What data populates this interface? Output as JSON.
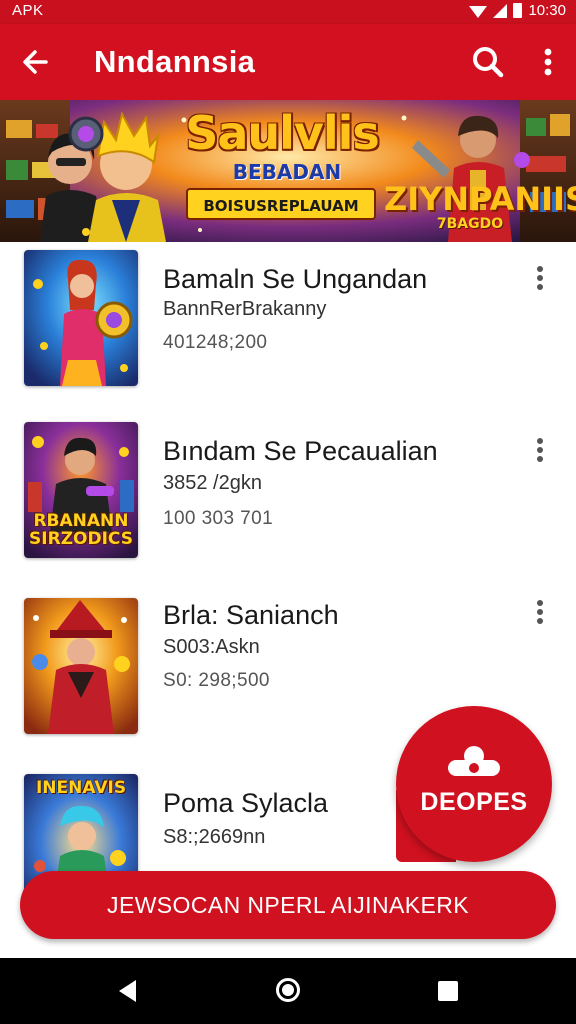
{
  "status_bar": {
    "left_text": "APK",
    "time": "10:30",
    "icons": [
      "wifi-icon",
      "signal-icon",
      "battery-icon"
    ]
  },
  "app_bar": {
    "title": "Nndannsia",
    "icons": [
      "back-arrow-icon",
      "search-icon",
      "more-vert-icon"
    ]
  },
  "banner": {
    "title": "Saulvlis",
    "subtitle_1": "BEBADAN",
    "subtitle_2": "BOISUSREPLAUAM",
    "right_title": "ZIYNPANIIS",
    "right_sub": "7BAGDO"
  },
  "items": [
    {
      "title": "Bamaln Se Ungandan",
      "subtitle": "BannRerBrakanny",
      "meta": "401248;200",
      "thumb_label": ""
    },
    {
      "title": "Bındam Se Pecaualian",
      "subtitle": "3852 /2gkn",
      "meta": "100 303 701",
      "thumb_label": "RBANANN SIRZODICS"
    },
    {
      "title": "Brla: Sanianch",
      "subtitle": "S003:Askn",
      "meta": "S0: 298;500",
      "thumb_label": ""
    },
    {
      "title": "Poma Sylacla",
      "subtitle": "S8:;2669nn",
      "meta": "",
      "thumb_label": "INENAVIS"
    }
  ],
  "fab": {
    "label": "DEOPES",
    "icon": "person-badge-icon"
  },
  "action_button": {
    "label": "JEWSOCAN NPERL AIJINAKERK"
  },
  "nav_bar": {
    "icons": [
      "nav-back-icon",
      "nav-home-icon",
      "nav-recents-icon"
    ]
  },
  "colors": {
    "primary_red": "#d0111f",
    "status_red": "#c8101e",
    "banner_gold": "#ffc21a",
    "banner_blue": "#1c3aa8"
  }
}
